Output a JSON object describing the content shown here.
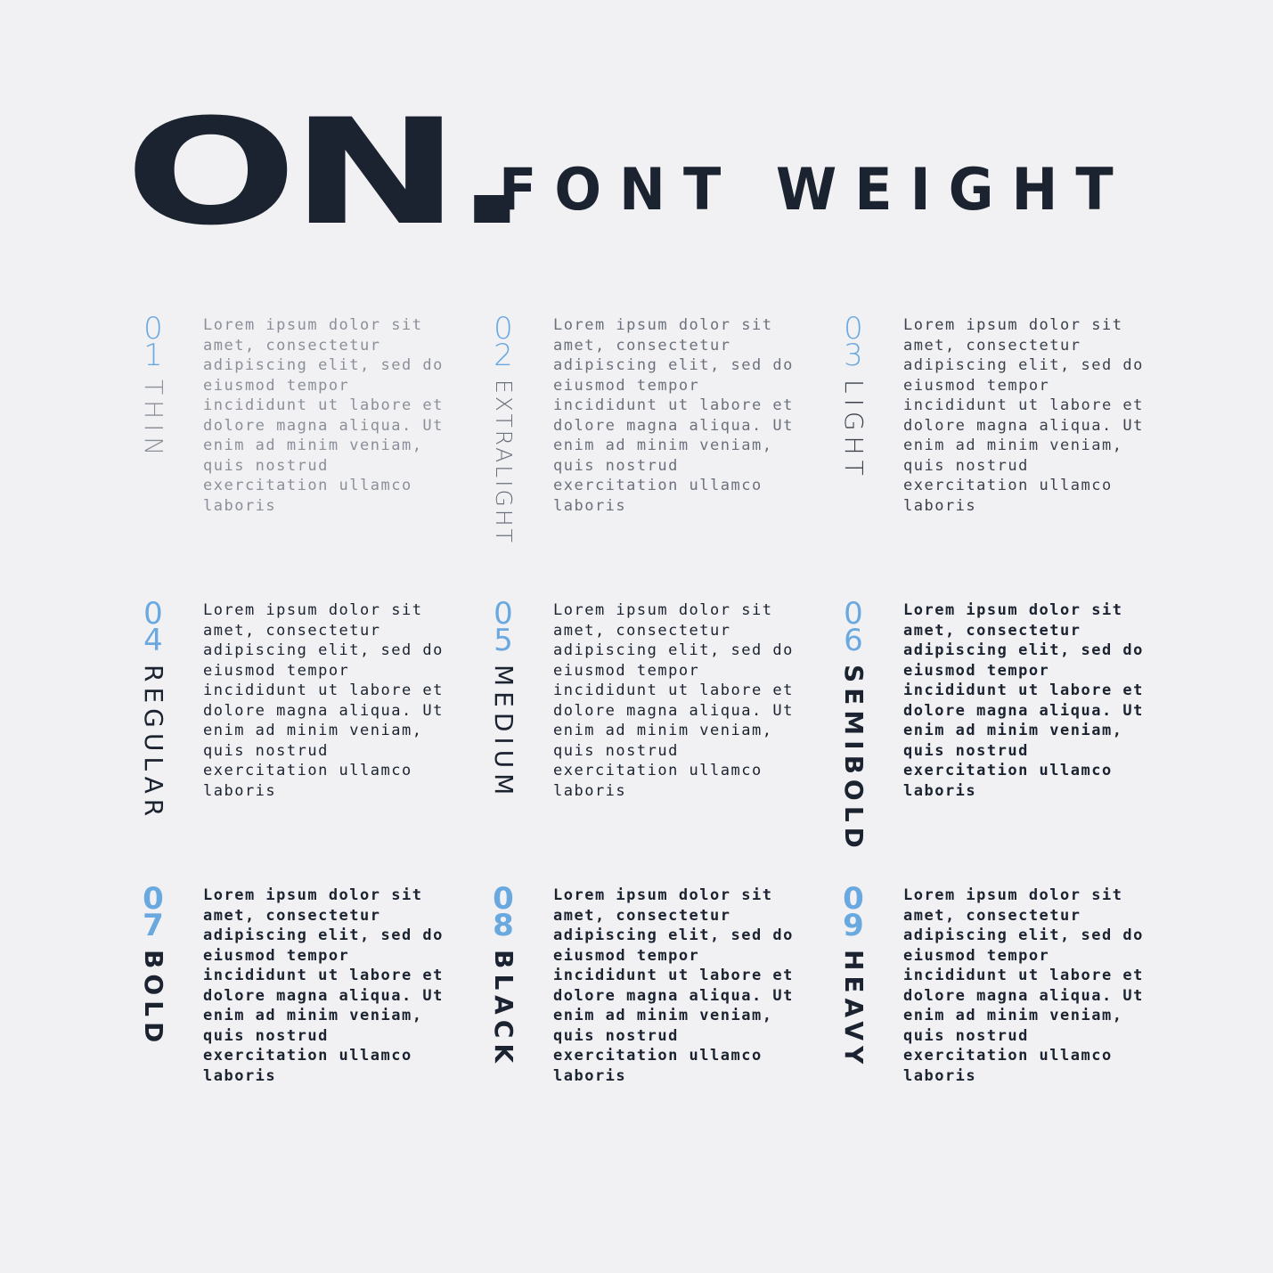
{
  "header": {
    "logo": "ON.",
    "title": "FONT WEIGHT"
  },
  "sample_text": "Lorem ipsum dolor sit amet, consectetur adipiscing elit, sed do eiusmod tempor incididunt ut labore et dolore magna aliqua. Ut enim ad minim veniam, quis nostrud exercitation ullamco laboris",
  "weights": [
    {
      "num_a": "0",
      "num_b": "1",
      "name": "THIN",
      "text": "Lorem ipsum dolor sit amet, consectetur adipiscing elit, sed do eiusmod tempor incididunt ut labore et dolore magna aliqua. Ut enim ad minim veniam, quis nostrud exercitation ullamco laboris"
    },
    {
      "num_a": "0",
      "num_b": "2",
      "name": "EXTRALIGHT",
      "text": "Lorem ipsum dolor sit amet, consectetur adipiscing elit, sed do eiusmod tempor incididunt ut labore et dolore magna aliqua. Ut enim ad minim veniam, quis nostrud exercitation ullamco laboris"
    },
    {
      "num_a": "0",
      "num_b": "3",
      "name": "LIGHT",
      "text": "Lorem ipsum dolor sit amet, consectetur adipiscing elit, sed do eiusmod tempor incididunt ut labore et dolore magna aliqua. Ut enim ad minim veniam, quis nostrud exercitation ullamco laboris"
    },
    {
      "num_a": "0",
      "num_b": "4",
      "name": "REGULAR",
      "text": "Lorem ipsum dolor sit amet, consectetur adipiscing elit, sed do eiusmod tempor incididunt ut labore et dolore magna aliqua. Ut enim ad minim veniam, quis nostrud exercitation ullamco laboris"
    },
    {
      "num_a": "0",
      "num_b": "5",
      "name": "MEDIUM",
      "text": "Lorem ipsum dolor sit amet, consectetur adipiscing elit, sed do eiusmod tempor incididunt ut labore et dolore magna aliqua. Ut enim ad minim veniam, quis nostrud exercitation ullamco laboris"
    },
    {
      "num_a": "0",
      "num_b": "6",
      "name": "SEMIBOLD",
      "text": "Lorem ipsum dolor sit amet, consectetur adipiscing elit, sed do eiusmod tempor incididunt ut labore et dolore magna aliqua. Ut enim ad minim veniam, quis nostrud exercitation ullamco laboris"
    },
    {
      "num_a": "0",
      "num_b": "7",
      "name": "BOLD",
      "text": "Lorem ipsum dolor sit amet, consectetur adipiscing elit, sed do eiusmod tempor incididunt ut labore et dolore magna aliqua. Ut enim ad minim veniam, quis nostrud exercitation ullamco laboris"
    },
    {
      "num_a": "0",
      "num_b": "8",
      "name": "BLACK",
      "text": "Lorem ipsum dolor sit amet, consectetur adipiscing elit, sed do eiusmod tempor incididunt ut labore et dolore magna aliqua. Ut enim ad minim veniam, quis nostrud exercitation ullamco laboris"
    },
    {
      "num_a": "0",
      "num_b": "9",
      "name": "HEAVY",
      "text": "Lorem ipsum dolor sit amet, consectetur adipiscing elit, sed do eiusmod tempor incididunt ut labore et dolore magna aliqua. Ut enim ad minim veniam, quis nostrud exercitation ullamco laboris"
    }
  ],
  "colors": {
    "background": "#f1f1f3",
    "ink": "#1b2330",
    "accent": "#6aa8e0"
  }
}
